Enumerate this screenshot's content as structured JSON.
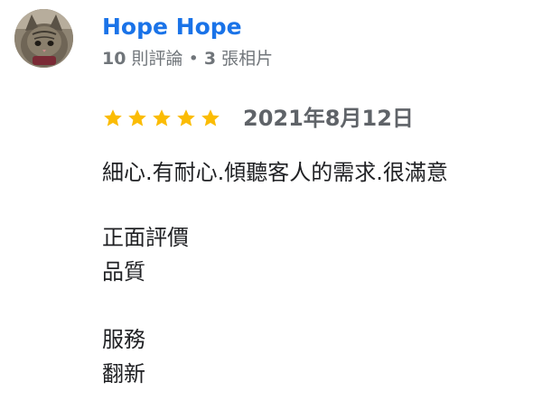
{
  "reviewer": {
    "name": "Hope Hope",
    "reviews_count": "10",
    "reviews_label": "則評論",
    "separator": "•",
    "photos_count": "3",
    "photos_label": "張相片"
  },
  "review": {
    "rating": 5,
    "rating_max": 5,
    "date": "2021年8月12日",
    "text": "細心.有耐心.傾聽客人的需求.很滿意"
  },
  "tag_groups": [
    {
      "heading": "正面評價",
      "value": "品質"
    },
    {
      "heading": "服務",
      "value": "翻新"
    }
  ],
  "colors": {
    "name": "#1a73e8",
    "star": "#fbbc04",
    "meta": "#70757a",
    "text": "#202124"
  }
}
